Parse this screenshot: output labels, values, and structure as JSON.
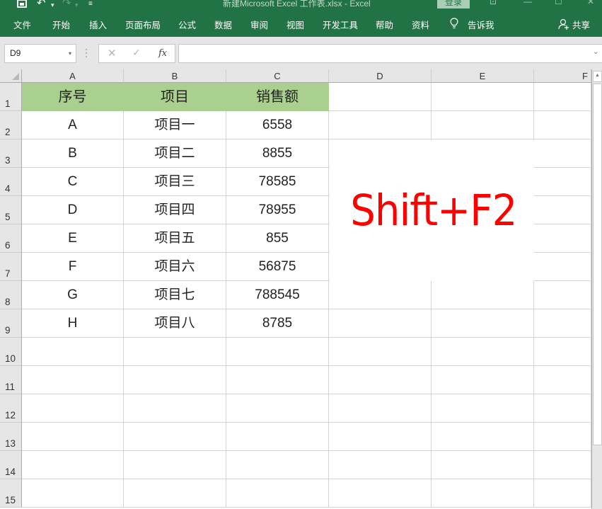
{
  "window": {
    "title": "新建Microsoft Excel 工作表.xlsx  -  Excel",
    "login_label": "登录",
    "ribbon_options_icon": "⊡",
    "minimize_icon": "—",
    "maximize_icon": "☐",
    "close_icon": "✕"
  },
  "quick_access": {
    "undo_icon": "↶",
    "dropdown_icon": "▾",
    "redo_icon": "↷",
    "customize_icon": "≡"
  },
  "ribbon": {
    "tabs": [
      "文件",
      "开始",
      "插入",
      "页面布局",
      "公式",
      "数据",
      "审阅",
      "视图",
      "开发工具",
      "帮助",
      "资料"
    ],
    "tell_me": "告诉我",
    "share": "共享"
  },
  "formula_bar": {
    "name_box": "D9",
    "name_box_arrow": "▾",
    "cancel_icon": "✕",
    "enter_icon": "✓",
    "fx_label": "fx",
    "formula_value": "",
    "expand_icon": "⌄"
  },
  "sheet": {
    "columns": [
      "A",
      "B",
      "C",
      "D",
      "E",
      "F"
    ],
    "rows": [
      "1",
      "2",
      "3",
      "4",
      "5",
      "6",
      "7",
      "8",
      "9",
      "10",
      "11",
      "12",
      "13",
      "14",
      "15"
    ],
    "header_fill": "#a9d08e",
    "table_headers": [
      "序号",
      "项目",
      "销售额"
    ],
    "table_rows": [
      [
        "A",
        "项目一",
        "6558"
      ],
      [
        "B",
        "项目二",
        "8855"
      ],
      [
        "C",
        "项目三",
        "78585"
      ],
      [
        "D",
        "项目四",
        "78955"
      ],
      [
        "E",
        "项目五",
        "855"
      ],
      [
        "F",
        "项目六",
        "56875"
      ],
      [
        "G",
        "项目七",
        "788545"
      ],
      [
        "H",
        "项目八",
        "8785"
      ]
    ],
    "selected_cell": "D9"
  },
  "overlay": {
    "text": "Shift+F2",
    "color": "#ff0000"
  },
  "scrollbar": {
    "up_icon": "▲"
  }
}
